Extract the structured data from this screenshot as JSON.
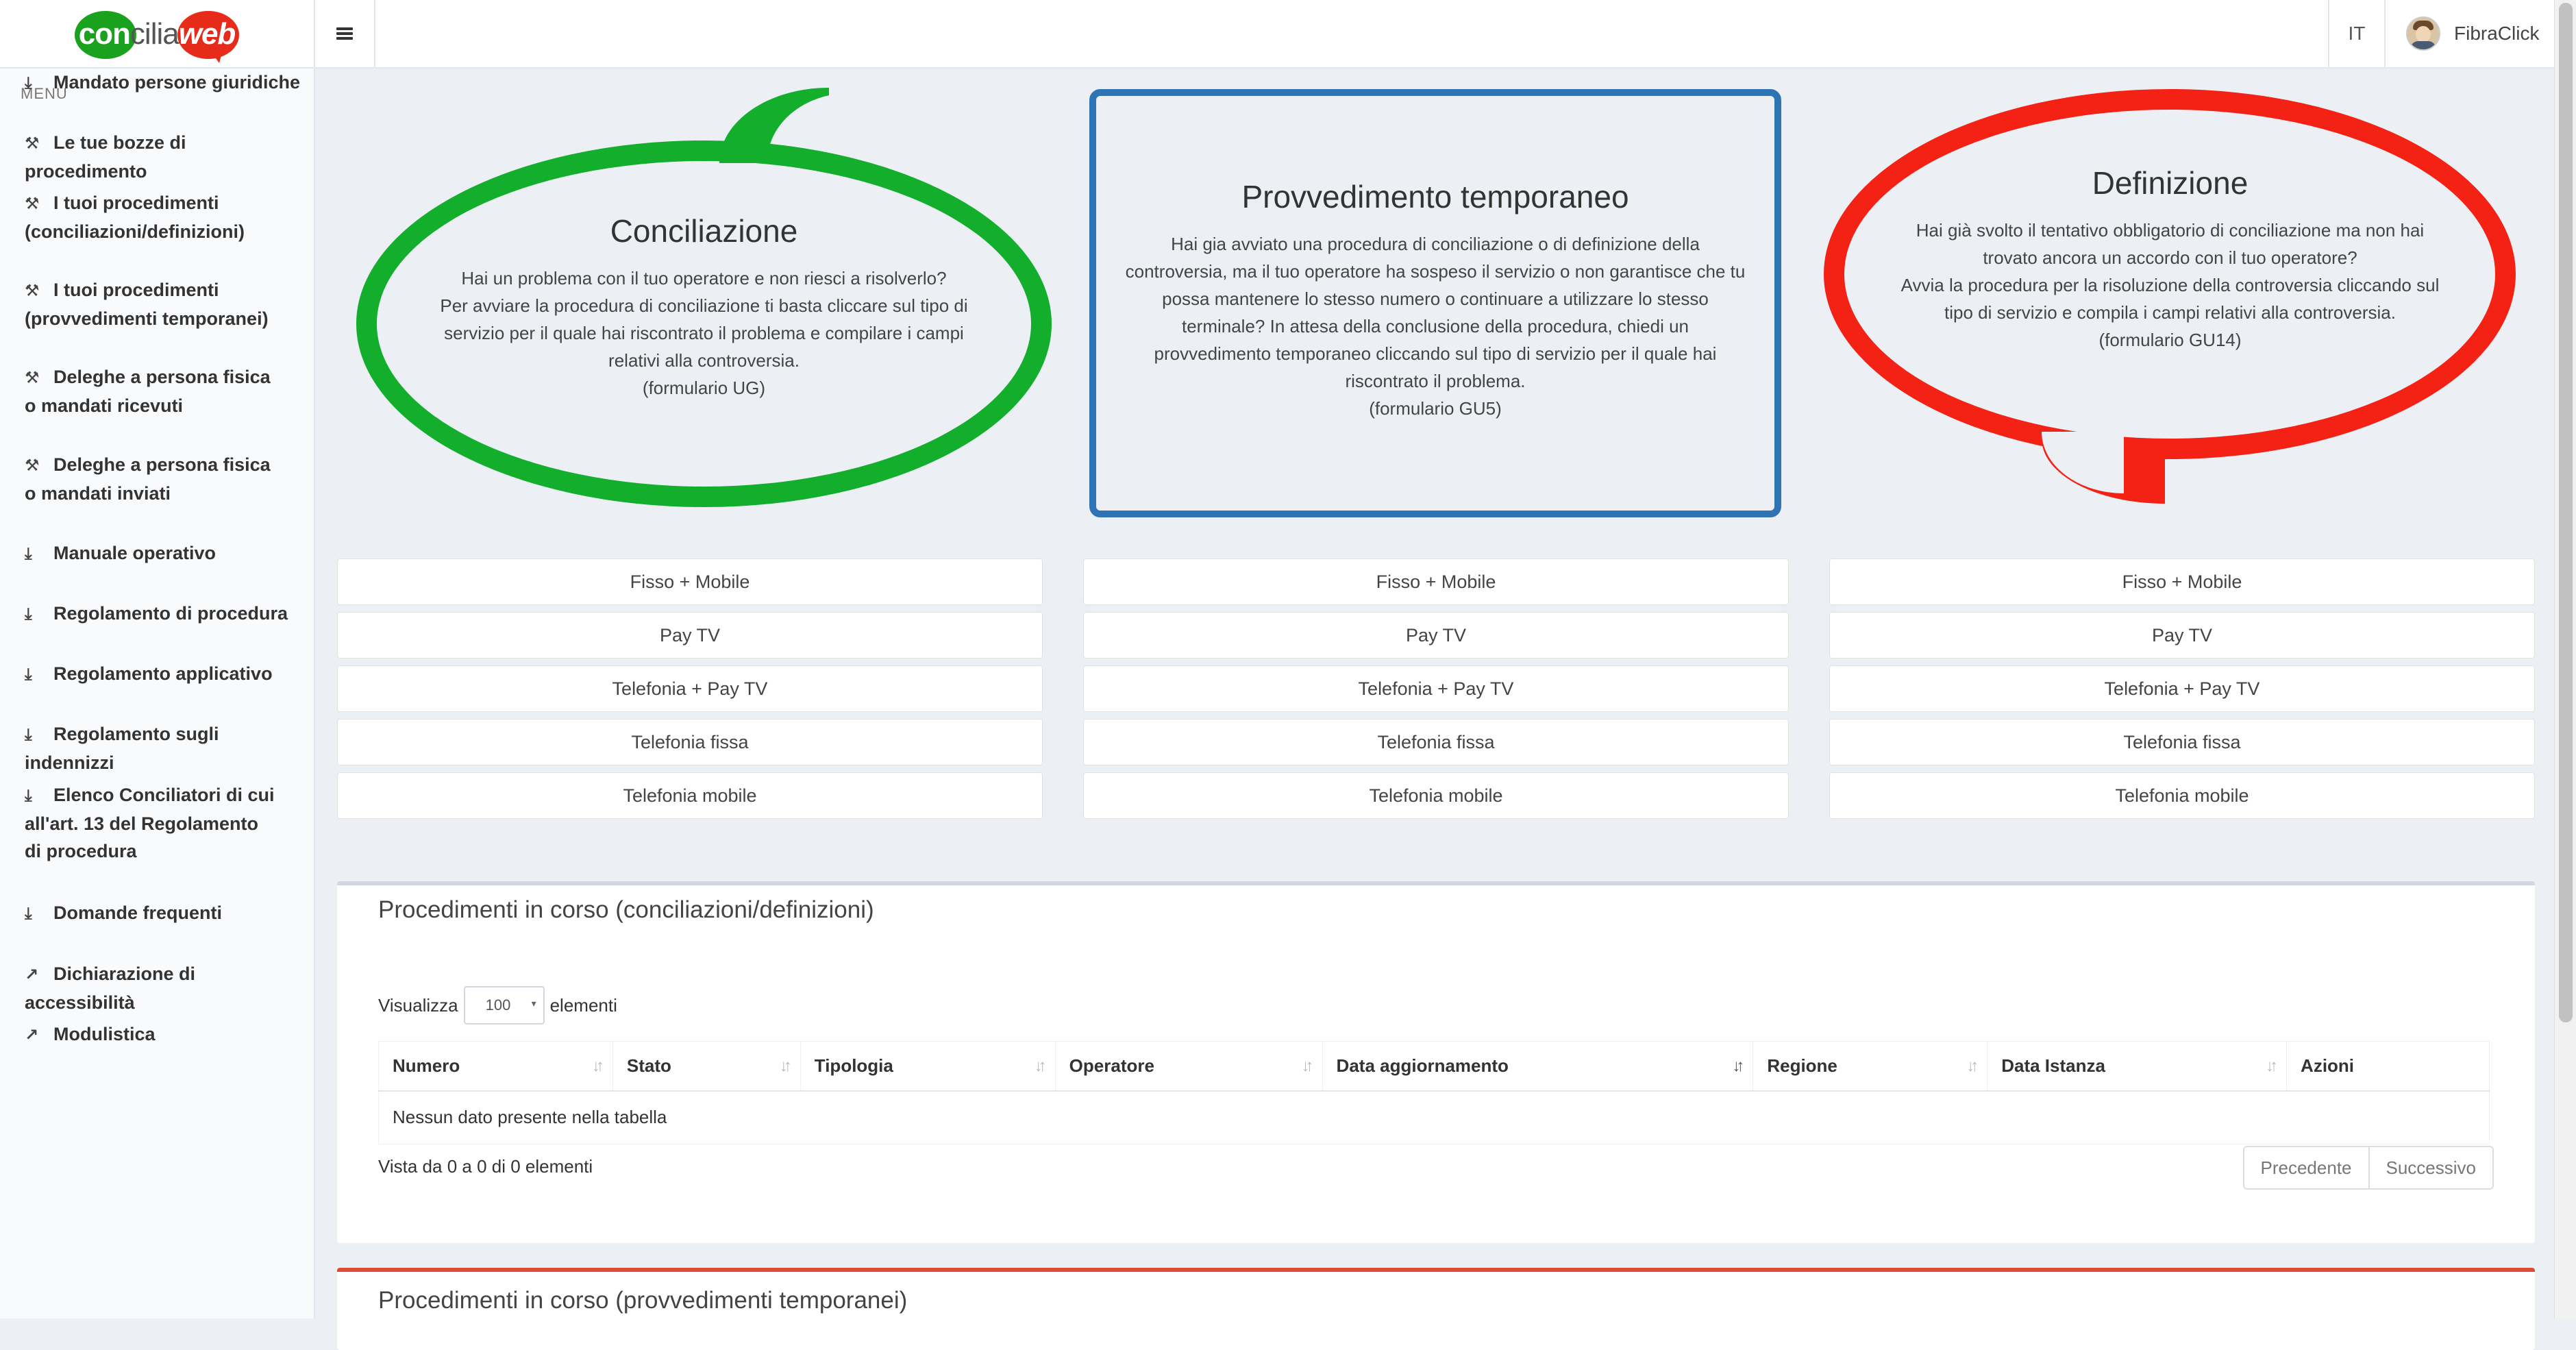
{
  "header": {
    "logo": {
      "part1": "con",
      "part2": "cilia",
      "part3": "web"
    },
    "language": "IT",
    "username": "FibraClick"
  },
  "sidebar": {
    "menu_header": "MENU",
    "items": [
      {
        "label": "Mandato persone giuridiche",
        "icon": "download-icon"
      },
      {
        "label": "Le tue bozze di procedimento",
        "icon": "gavel-icon"
      },
      {
        "label": "I tuoi procedimenti\n(conciliazioni/definizioni)",
        "icon": "gavel-icon"
      },
      {
        "label": "I tuoi procedimenti\n(provvedimenti temporanei)",
        "icon": "gavel-icon"
      },
      {
        "label": "Deleghe a persona fisica\no mandati ricevuti",
        "icon": "gavel-icon"
      },
      {
        "label": "Deleghe a persona fisica\no mandati inviati",
        "icon": "gavel-icon"
      },
      {
        "label": "Manuale operativo",
        "icon": "download-icon"
      },
      {
        "label": "Regolamento di procedura",
        "icon": "download-icon"
      },
      {
        "label": "Regolamento applicativo",
        "icon": "download-icon"
      },
      {
        "label": "Regolamento sugli indennizzi",
        "icon": "download-icon"
      },
      {
        "label": "Elenco Conciliatori di cui\nall'art. 13 del Regolamento\ndi procedura",
        "icon": "download-icon"
      },
      {
        "label": "Domande frequenti",
        "icon": "download-icon"
      },
      {
        "label": "Dichiarazione di accessibilità",
        "icon": "external-link-icon"
      },
      {
        "label": "Modulistica",
        "icon": "external-link-icon"
      }
    ]
  },
  "cards": {
    "conciliazione": {
      "title": "Conciliazione",
      "description": "Hai un problema con il tuo operatore e non riesci a risolverlo?\nPer avviare la procedura di conciliazione ti basta cliccare sul tipo di\nservizio per il quale hai riscontrato il problema e compilare i campi\nrelativi alla controversia.\n(formulario UG)",
      "color": "#12ae2c"
    },
    "provvedimento": {
      "title": "Provvedimento temporaneo",
      "description": "Hai gia avviato una procedura di conciliazione o di definizione della\ncontroversia, ma il tuo operatore ha sospeso il servizio o non garantisce che tu\npossa mantenere lo stesso numero o continuare a utilizzare lo stesso\nterminale? In attesa della conclusione della procedura, chiedi un\nprovvedimento temporaneo cliccando sul tipo di servizio per il quale hai\nriscontrato il problema.\n(formulario GU5)",
      "color": "#2e74b5"
    },
    "definizione": {
      "title": "Definizione",
      "description": "Hai già svolto il tentativo obbligatorio di conciliazione ma non hai\ntrovato ancora un accordo con il tuo operatore?\nAvvia la procedura per la risoluzione della controversia cliccando sul\ntipo di servizio e compila i campi relativi alla controversia.\n(formulario GU14)",
      "color": "#f42214"
    }
  },
  "services": [
    "Fisso + Mobile",
    "Pay TV",
    "Telefonia + Pay TV",
    "Telefonia fissa",
    "Telefonia mobile"
  ],
  "panel1": {
    "title": "Procedimenti in corso (conciliazioni/definizioni)",
    "length_label_before": "Visualizza",
    "length_value": "100",
    "length_label_after": "elementi",
    "columns": [
      "Numero",
      "Stato",
      "Tipologia",
      "Operatore",
      "Data aggiornamento",
      "Regione",
      "Data Istanza",
      "Azioni"
    ],
    "empty_message": "Nessun dato presente nella tabella",
    "info": "Vista da 0 a 0 di 0 elementi",
    "prev_label": "Precedente",
    "next_label": "Successivo"
  },
  "panel2": {
    "title": "Procedimenti in corso (provvedimenti temporanei)"
  }
}
